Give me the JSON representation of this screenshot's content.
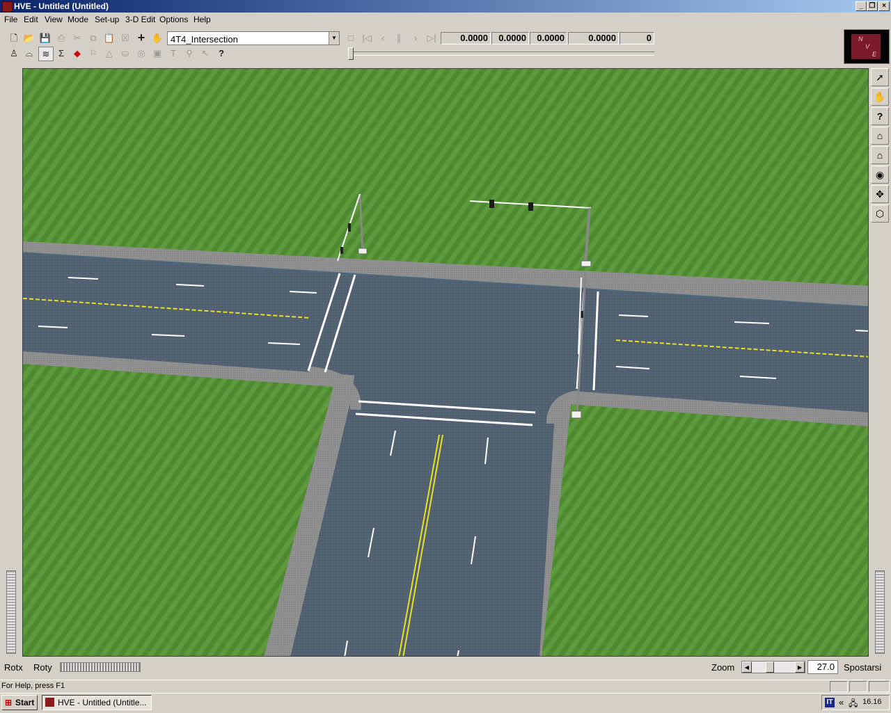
{
  "window": {
    "title": "HVE - Untitled (Untitled)"
  },
  "menu": [
    "File",
    "Edit",
    "View",
    "Mode",
    "Set-up",
    "3-D Edit",
    "Options",
    "Help"
  ],
  "toolbar": {
    "scene_select": "4T4_Intersection",
    "readouts": [
      "0.0000",
      "0.0000",
      "0.0000",
      "0.0000",
      "0"
    ],
    "help_label": "?"
  },
  "compass": {
    "n": "N",
    "v": "V",
    "e": "E"
  },
  "right_toolbar": {
    "icons": [
      "pointer-icon",
      "hand-icon",
      "question-icon",
      "home-icon",
      "home-arrow-icon",
      "eye-icon",
      "move-icon",
      "cube-icon"
    ]
  },
  "bottom": {
    "rotx": "Rotx",
    "roty": "Roty",
    "zoom_label": "Zoom",
    "zoom_value": "27.0",
    "pan_label": "Spostarsi"
  },
  "status": {
    "text": "For Help, press F1"
  },
  "taskbar": {
    "start": "Start",
    "task": "HVE - Untitled (Untitle...",
    "lang": "IT",
    "chevron": "«",
    "clock": "16.16"
  },
  "colors": {
    "grass": "#4f8a32",
    "road": "#526273",
    "curb": "#8c8c8c",
    "yellow_line": "#e8e020",
    "title_start": "#0a246a",
    "title_end": "#a6caf0"
  }
}
